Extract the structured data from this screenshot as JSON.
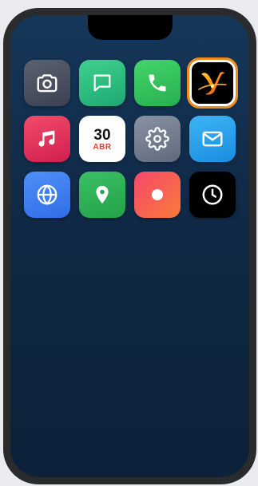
{
  "home_screen": {
    "apps": [
      {
        "id": "camera",
        "icon": "camera-icon"
      },
      {
        "id": "messages",
        "icon": "chat-bubble-icon"
      },
      {
        "id": "phone",
        "icon": "phone-handset-icon"
      },
      {
        "id": "custom-app",
        "icon": "stylized-y-logo-icon",
        "selected": true
      },
      {
        "id": "music",
        "icon": "music-note-icon"
      },
      {
        "id": "calendar",
        "icon": "calendar-icon",
        "day": "30",
        "month": "ABR"
      },
      {
        "id": "settings",
        "icon": "gear-icon"
      },
      {
        "id": "mail",
        "icon": "envelope-icon"
      },
      {
        "id": "browser",
        "icon": "globe-icon"
      },
      {
        "id": "maps",
        "icon": "map-pin-icon"
      },
      {
        "id": "recorder",
        "icon": "record-dot-icon"
      },
      {
        "id": "clock",
        "icon": "clock-icon"
      }
    ]
  },
  "colors": {
    "wallpaper_top": "#16375a",
    "wallpaper_bottom": "#0d2139",
    "selection_outline": "#f08a18",
    "calendar_month": "#ea3a3a"
  }
}
